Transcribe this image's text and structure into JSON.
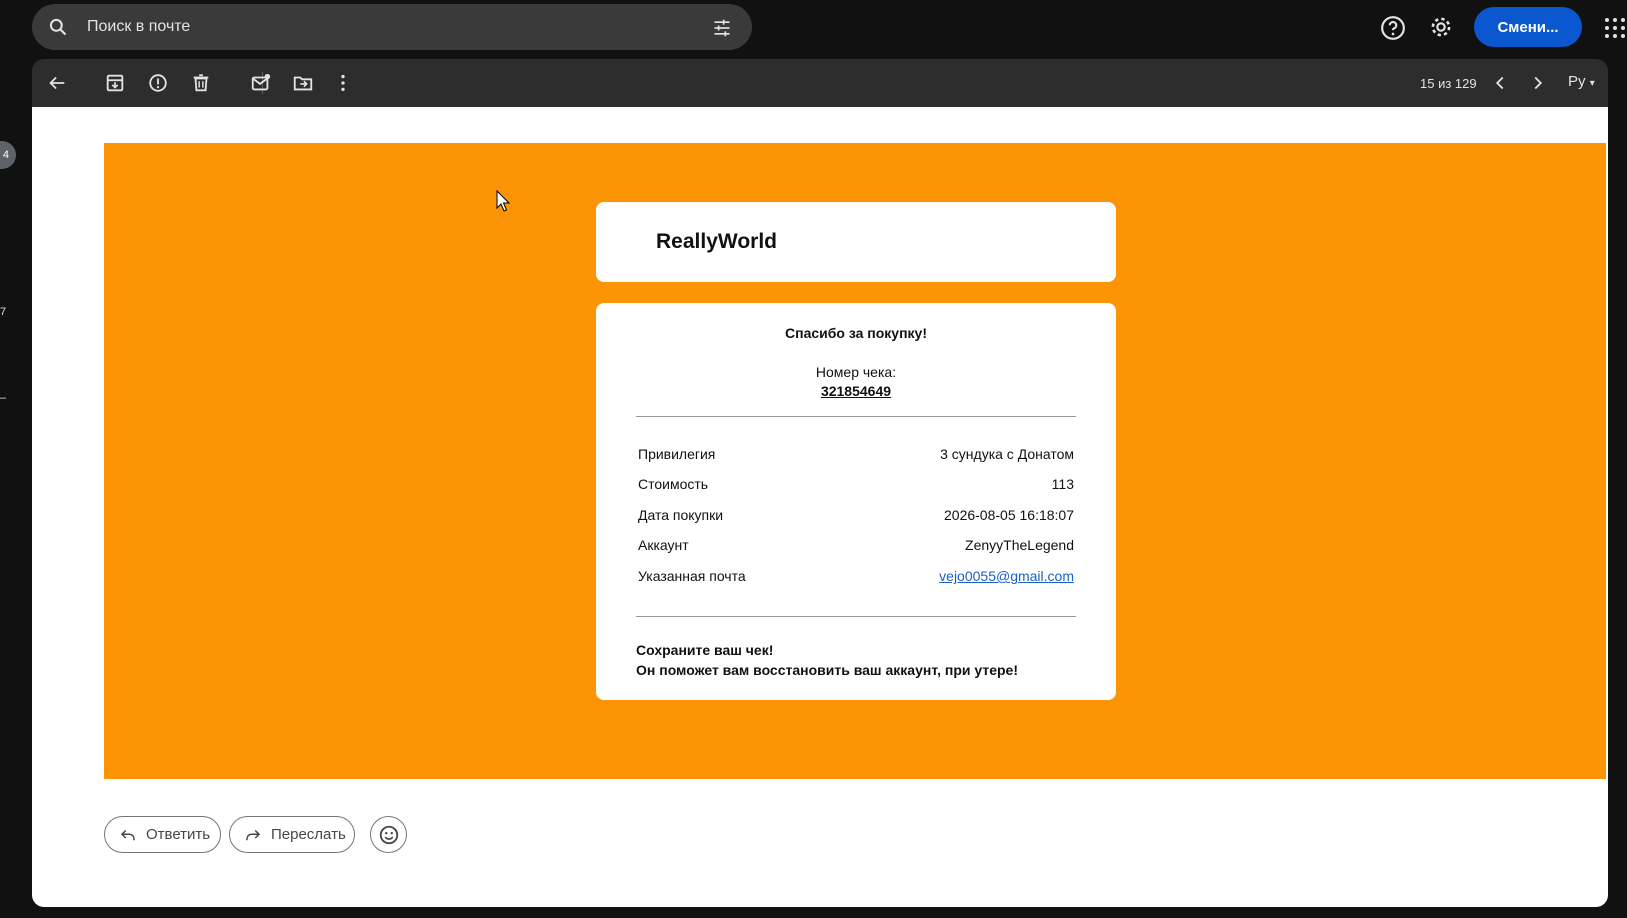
{
  "search": {
    "placeholder": "Поиск в почте",
    "icon": "search-icon",
    "filter_icon": "tune-icon"
  },
  "header": {
    "switch_label": "Смени...",
    "help_icon": "help-icon",
    "settings_icon": "gear-icon",
    "apps_icon": "apps-grid-icon"
  },
  "left_rail": {
    "badge": "4",
    "mark_a": "7",
    "mark_b": "–"
  },
  "toolbar": {
    "icons": [
      "back-arrow-icon",
      "archive-icon",
      "report-spam-icon",
      "delete-icon",
      "mark-unread-icon",
      "move-to-icon",
      "more-vert-icon"
    ],
    "pager": "15 из 129",
    "lang": "Ру"
  },
  "email": {
    "brand": "ReallyWorld",
    "thanks": "Спасибо за покупку!",
    "receipt_label": "Номер чека:",
    "receipt_number": "321854649",
    "rows": [
      {
        "key": "Привилегия",
        "value": "3 сундука с Донатом"
      },
      {
        "key": "Стоимость",
        "value": "113"
      },
      {
        "key": "Дата покупки",
        "value": "2026-08-05 16:18:07"
      },
      {
        "key": "Аккаунт",
        "value": "ZenyyTheLegend"
      },
      {
        "key": "Указанная почта",
        "value": "vejo0055@gmail.com"
      }
    ],
    "note_line1": "Сохраните ваш чек!",
    "note_line2": "Он поможет вам восстановить ваш аккаунт, при утере!",
    "accent_color": "#fd9406"
  },
  "actions": {
    "reply": "Ответить",
    "forward": "Переслать",
    "emoji_icon": "emoji-icon"
  }
}
